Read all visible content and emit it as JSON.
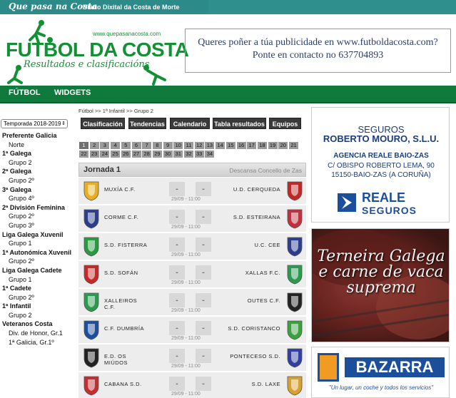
{
  "topbar": {
    "logo": "Que pasa na Costa",
    "tagline": "Diario Dixital da Costa de Morte"
  },
  "header": {
    "url": "www.quepasanacosta.com",
    "title": "FUTBOL DA COSTA",
    "subtitle": "Resultados e clasificacións",
    "ad_line1": "Queres poñer a túa publicidade en www.futboldacosta.com?",
    "ad_line2": "Ponte en contacto no 637704893"
  },
  "nav": {
    "items": [
      "FÚTBOL",
      "WIDGETS"
    ]
  },
  "season": {
    "selected": "Temporada 2018-2019"
  },
  "sidebar": {
    "items": [
      {
        "label": "Preferente Galicia",
        "type": "head"
      },
      {
        "label": "Norte",
        "type": "sub"
      },
      {
        "label": "1ª Galega",
        "type": "head"
      },
      {
        "label": "Grupo 2",
        "type": "sub"
      },
      {
        "label": "2ª Galega",
        "type": "head"
      },
      {
        "label": "Grupo 2º",
        "type": "sub"
      },
      {
        "label": "3ª Galega",
        "type": "head"
      },
      {
        "label": "Grupo 4º",
        "type": "sub"
      },
      {
        "label": "2ª División Feminina",
        "type": "head"
      },
      {
        "label": "Grupo 2º",
        "type": "sub"
      },
      {
        "label": "Grupo 3º",
        "type": "sub"
      },
      {
        "label": "Liga Galega Xuvenil",
        "type": "head"
      },
      {
        "label": "Grupo 1",
        "type": "sub"
      },
      {
        "label": "1ª Autonómica Xuvenil",
        "type": "head"
      },
      {
        "label": "Grupo 2º",
        "type": "sub"
      },
      {
        "label": "Liga Galega Cadete",
        "type": "head"
      },
      {
        "label": "Grupo 1",
        "type": "sub"
      },
      {
        "label": "1ª Cadete",
        "type": "head"
      },
      {
        "label": "Grupo 2º",
        "type": "sub"
      },
      {
        "label": "1ª Infantil",
        "type": "head"
      },
      {
        "label": "Grupo 2",
        "type": "sub"
      },
      {
        "label": "Veteranos Costa",
        "type": "head"
      },
      {
        "label": "Div. de Honor, Gr.1",
        "type": "sub"
      },
      {
        "label": "1ª Galicia, Gr.1º",
        "type": "sub"
      }
    ]
  },
  "breadcrumb": "Fútbol  >> 1ª Infantil  >> Grupo 2",
  "tabs": [
    "Clasificación",
    "Tendencias",
    "Calendario",
    "Tabla resultados",
    "Equipos"
  ],
  "rounds": [
    "1",
    "2",
    "3",
    "4",
    "5",
    "6",
    "7",
    "8",
    "9",
    "10",
    "11",
    "12",
    "13",
    "14",
    "15",
    "16",
    "17",
    "18",
    "19",
    "20",
    "21",
    "22",
    "23",
    "24",
    "25",
    "26",
    "27",
    "28",
    "29",
    "30",
    "31",
    "32",
    "33",
    "34"
  ],
  "selected_round": "1",
  "jornada": {
    "title": "Jornada 1",
    "note": "Descansa Concello de Zas"
  },
  "matches": [
    {
      "home": "MUXÍA C.F.",
      "away": "U.D. CERQUEDA",
      "score_home": "-",
      "score_away": "-",
      "date": "29/09 - 11:00",
      "home_color": "#e8b020",
      "away_color": "#c02828"
    },
    {
      "home": "CORME C.F.",
      "away": "S.D. ESTEIRANA",
      "score_home": "-",
      "score_away": "-",
      "date": "29/09 - 11:00",
      "home_color": "#2a3e8a",
      "away_color": "#c03040"
    },
    {
      "home": "S.D. FISTERRA",
      "away": "U.C. CEE",
      "score_home": "-",
      "score_away": "-",
      "date": "29/09 - 11:00",
      "home_color": "#2a9a40",
      "away_color": "#2b3d8c"
    },
    {
      "home": "S.D. SOFÁN",
      "away": "XALLAS F.C.",
      "score_home": "-",
      "score_away": "-",
      "date": "29/09 - 11:00",
      "home_color": "#c62828",
      "away_color": "#2a9a50"
    },
    {
      "home": "XALLEIROS C.F.",
      "away": "OUTES C.F.",
      "score_home": "-",
      "score_away": "-",
      "date": "29/09 - 11:00",
      "home_color": "#2a9a50",
      "away_color": "#222222"
    },
    {
      "home": "C.F. DUMBRÍA",
      "away": "S.D. CORISTANCO",
      "score_home": "-",
      "score_away": "-",
      "date": "29/09 - 11:00",
      "home_color": "#1b4e9b",
      "away_color": "#3aa040"
    },
    {
      "home": "E.D. OS MIÚDOS",
      "away": "PONTECESO S.D.",
      "score_home": "-",
      "score_away": "-",
      "date": "29/09 - 11:00",
      "home_color": "#222222",
      "away_color": "#3040a0"
    },
    {
      "home": "CABANA S.D.",
      "away": "S.D. LAXE",
      "score_home": "-",
      "score_away": "-",
      "date": "29/09 - 11:00",
      "home_color": "#c03030",
      "away_color": "#d8a030"
    }
  ],
  "ads": {
    "seguros_l1": "SEGUROS",
    "seguros_l2": "ROBERTO MOURO, S.L.U.",
    "seguros_l3": "AGENCIA REALE BAIO-ZAS",
    "seguros_l4": "C/ OBISPO ROBERTO LEMA, 90",
    "seguros_l5": "15150-BAIO-ZAS (A CORUÑA)",
    "reale_name": "REALE",
    "reale_sub": "SEGUROS",
    "terneira": "Terneira Galega e carne de vaca suprema",
    "bazarra_name": "BAZARRA",
    "bazarra_slogan": "\"Un lugar, un coche y todos los servicios\""
  },
  "colors": {
    "brand_green": "#119134",
    "nav_green": "#107a3c",
    "topbar_teal": "#2c8a88"
  }
}
